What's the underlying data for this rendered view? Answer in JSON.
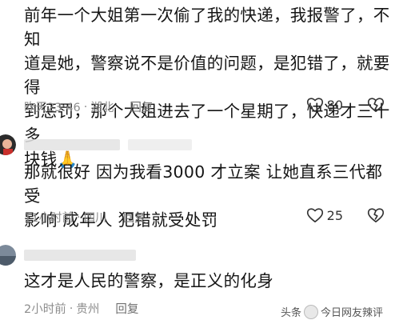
{
  "comments": [
    {
      "text_lines": [
        "前年一个大姐第一次偷了我的快递，我报警了，不知",
        "道是她，警察说不是价值的问题，是犯错了，就要得",
        "到惩罚，那个大姐进去了一个星期了，快递才三十多",
        "块钱🙏"
      ],
      "time": "昨天23:46",
      "location": "湖北",
      "reply_label": "回复",
      "likes": "80"
    },
    {
      "text_lines": [
        "那就很好 因为我看3000 才立案  让她直系三代都受",
        "影响  成年人  犯错就受处罚"
      ],
      "time": "11小时前",
      "location": "四川",
      "reply_label": "回复",
      "likes": "25"
    },
    {
      "text_lines": [
        "这才是人民的警察，是正义的化身"
      ],
      "time": "2小时前",
      "location": "贵州",
      "reply_label": "回复",
      "likes": ""
    }
  ],
  "meta_separator": "·",
  "watermark": {
    "prefix": "头条",
    "name": "今日网友辣评"
  },
  "icons": {
    "like": "heart-outline-icon",
    "dislike": "broken-heart-icon"
  },
  "colors": {
    "text": "#151515",
    "meta": "#8d8d8d",
    "background": "#ffffff"
  }
}
